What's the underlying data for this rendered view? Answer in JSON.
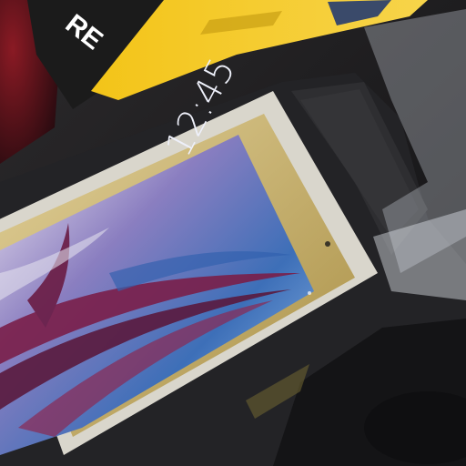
{
  "scene": {
    "description_label": "photo",
    "phone": {
      "clock": "12:45",
      "screen_colors": {
        "top": "#3a3f8f",
        "mid": "#6a8fd8",
        "accent": "#7a1f4a",
        "light": "#e6e8f4"
      },
      "frame_color": "#cbb56a"
    },
    "box": {
      "brand_text": "RE",
      "box_color": "#f2c21a",
      "box_dark": "#1b1b1b"
    },
    "bag_color": "#2a2a2e",
    "plastic_color": "#d8dde2"
  }
}
